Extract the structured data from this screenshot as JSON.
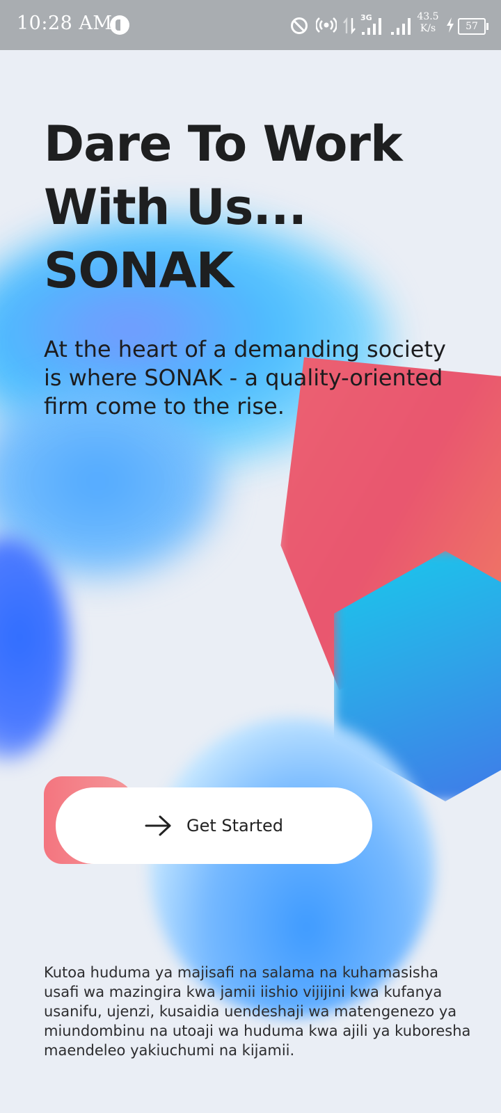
{
  "status_bar": {
    "time": "10:28 AM",
    "network_type": "3G",
    "speed_value": "43.5",
    "speed_unit": "K/s",
    "battery_level": "57",
    "icons": [
      "app-icon",
      "do-not-disturb-icon",
      "hotspot-icon",
      "data-arrows-icon",
      "signal-3g-icon",
      "signal-icon",
      "charging-icon",
      "battery-icon"
    ]
  },
  "hero": {
    "headline_lines": [
      "Dare To Work",
      "With Us...",
      "SONAK"
    ],
    "intro": "At the heart of a demanding society is where SONAK - a quality-oriented firm come to the rise."
  },
  "cta": {
    "label": "Get Started",
    "icon": "arrow-right-icon"
  },
  "footer": {
    "text": "Kutoa huduma ya majisafi na salama na kuhamasisha usafi wa mazingira kwa jamii iishio vijijini kwa kufanya usanifu, ujenzi, kusaidia uendeshaji wa matengenezo ya miundombinu na utoaji wa huduma kwa ajili ya kuboresha maendeleo yakiuchumi na kijamii."
  },
  "colors": {
    "background": "#eaeef5",
    "status_bar": "#a9adb1",
    "text_primary": "#1e1f20",
    "accent_pink": "#f4757f",
    "shape_red": "#e9566f",
    "shape_cyan": "#19c9ec",
    "shape_blue": "#3f9bff"
  }
}
